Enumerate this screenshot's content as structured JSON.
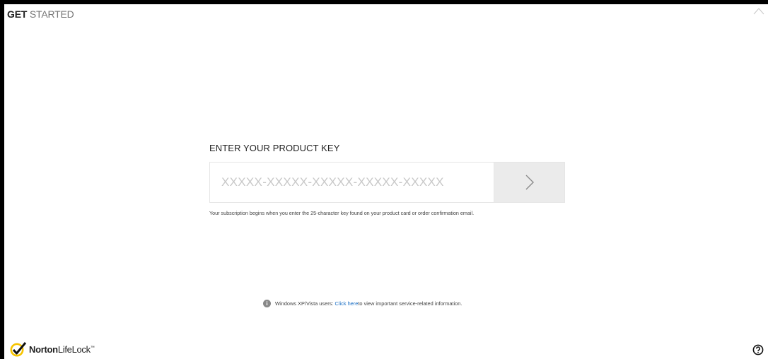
{
  "window": {
    "title_part1": "GET",
    "title_part2": " STARTED"
  },
  "product_key": {
    "heading": "ENTER YOUR PRODUCT KEY",
    "placeholder": "XXXXX-XXXXX-XXXXX-XXXXX-XXXXX",
    "value": "",
    "submit_icon": "chevron-right-icon",
    "note": "Your subscription begins when you enter the 25-character key found on your product card or order confirmation email."
  },
  "info": {
    "icon": "info-icon",
    "prefix": "Windows XP/Vista users: ",
    "link": "Click here",
    "suffix": " to view important service-related information."
  },
  "brand": {
    "name_part1": "Norton",
    "name_part2": "LifeLock",
    "tm": "™",
    "logo_color": "#f7c400"
  },
  "help": {
    "icon": "help-icon"
  }
}
